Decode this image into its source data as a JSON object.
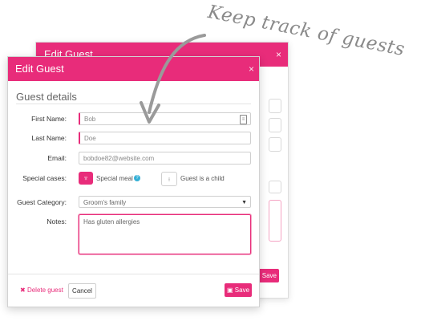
{
  "caption": "Keep track of guests",
  "back_window": {
    "title": "Edit Guest",
    "close_glyph": "×",
    "save_label": "Save"
  },
  "window": {
    "title": "Edit Guest",
    "close_glyph": "×",
    "section_title": "Guest details",
    "fields": {
      "first_name": {
        "label": "First Name:",
        "value": "Bob"
      },
      "last_name": {
        "label": "Last Name:",
        "value": "Doe"
      },
      "email": {
        "label": "Email:",
        "value": "bobdoe82@website.com"
      }
    },
    "special_cases": {
      "label": "Special cases:",
      "special_meal_label": "Special meal",
      "guest_child_label": "Guest is a child"
    },
    "guest_category": {
      "label": "Guest Category:",
      "value": "Groom's family"
    },
    "notes": {
      "label": "Notes:",
      "value": "Has gluten allergies"
    },
    "footer": {
      "delete_label": "Delete guest",
      "cancel_label": "Cancel",
      "save_label": "Save"
    }
  },
  "colors": {
    "accent": "#e82c7a",
    "help": "#35b0d6"
  },
  "icons": [
    "close-icon",
    "contact-card-icon",
    "fork-knife-icon",
    "question-icon",
    "child-icon",
    "chevron-down-icon",
    "delete-x-icon",
    "save-floppy-icon"
  ]
}
